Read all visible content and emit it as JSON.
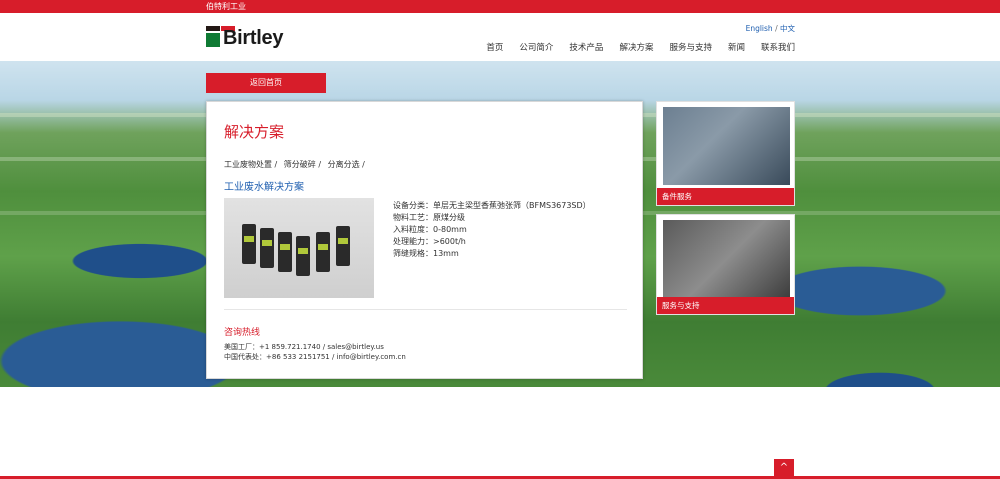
{
  "topbar": {
    "brand_cn": "伯特利工业"
  },
  "header": {
    "logo_text": "Birtley",
    "lang_en": "English",
    "lang_sep": "/",
    "lang_cn": "中文",
    "nav": [
      "首页",
      "公司简介",
      "技术产品",
      "解决方案",
      "服务与支持",
      "新闻",
      "联系我们"
    ]
  },
  "back_button": "返回首页",
  "main": {
    "title": "解决方案",
    "breadcrumbs": [
      "工业废物处置 /",
      "筛分破碎 /",
      "分离分选 /"
    ],
    "subtitle": "工业废水解决方案",
    "specs": [
      "设备分类：单层无主梁型香蕉弛张筛（BFMS3673SD）",
      "物料工艺：原煤分级",
      "入料粒度：0-80mm",
      "处理能力：>600t/h",
      "筛缝规格：13mm"
    ],
    "hotline_title": "咨询热线",
    "contacts": [
      "美国工厂：+1 859.721.1740 / sales@birtley.us",
      "中国代表处：+86 533 2151751 / info@birtley.com.cn"
    ]
  },
  "sidebar": {
    "cards": [
      {
        "label": "备件服务"
      },
      {
        "label": "服务与支持"
      }
    ]
  },
  "back_to_top": "^"
}
